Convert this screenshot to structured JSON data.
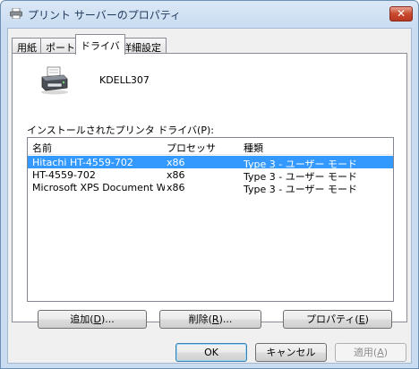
{
  "window": {
    "title": "プリント サーバーのプロパティ",
    "close_glyph": "✕"
  },
  "tabs": [
    {
      "label": "用紙",
      "active": false
    },
    {
      "label": "ポート",
      "active": false
    },
    {
      "label": "ドライバ",
      "active": true
    },
    {
      "label": "詳細設定",
      "active": false
    }
  ],
  "server": {
    "name": "KDELL307",
    "icon": "printer-icon"
  },
  "drivers": {
    "label": "インストールされたプリンタ ドライバ(P):",
    "columns": [
      "名前",
      "プロセッサ",
      "種類"
    ],
    "rows": [
      {
        "name": "Hitachi HT-4559-702",
        "processor": "x86",
        "type": "Type 3 - ユーザー モード",
        "selected": true
      },
      {
        "name": "HT-4559-702",
        "processor": "x86",
        "type": "Type 3 - ユーザー モード",
        "selected": false
      },
      {
        "name": "Microsoft XPS Document W...",
        "processor": "x86",
        "type": "Type 3 - ユーザー モード",
        "selected": false
      }
    ]
  },
  "actions": {
    "add": {
      "pre": "追加(",
      "key": "D",
      "post": ")..."
    },
    "remove": {
      "pre": "削除(",
      "key": "R",
      "post": ")..."
    },
    "properties": {
      "pre": "プロパティ(",
      "key": "E",
      "post": ")"
    }
  },
  "footer": {
    "ok": "OK",
    "cancel": "キャンセル",
    "apply": {
      "pre": "適用(",
      "key": "A",
      "post": ")"
    }
  },
  "colors": {
    "selection": "#3399ff",
    "titlebar": "#c9dcf1",
    "close_button": "#c84a2f"
  }
}
